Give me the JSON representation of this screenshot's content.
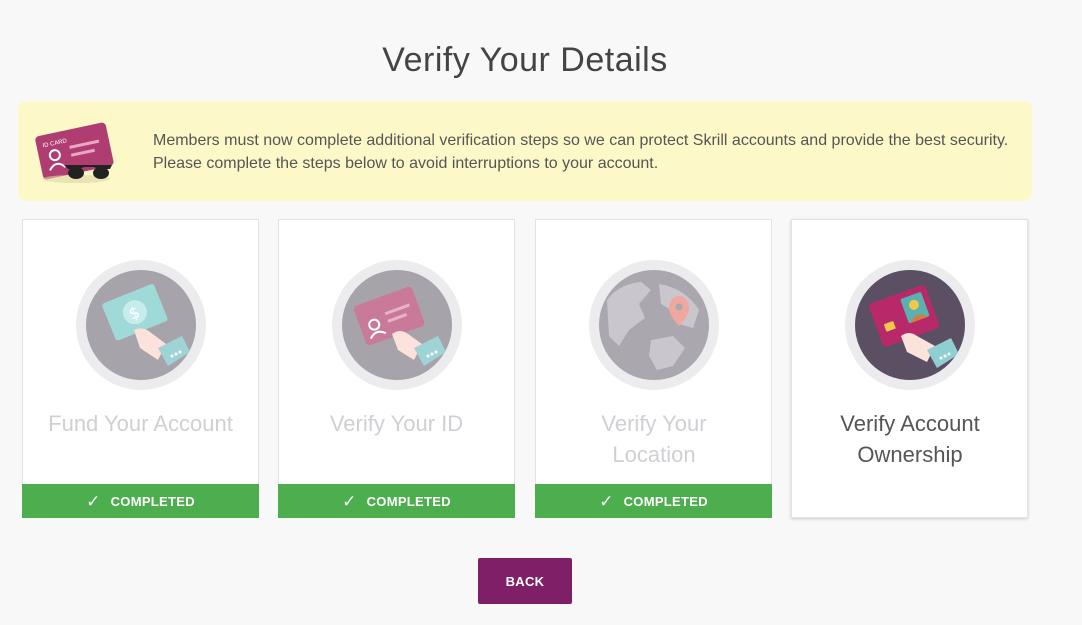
{
  "page": {
    "title": "Verify Your Details"
  },
  "notice": {
    "icon": "id-card-sunglasses-icon",
    "card_text": "ID CARD",
    "text": "Members must now complete additional verification steps so we can protect Skrill accounts and provide the best security. Please complete the steps below to avoid interruptions to your account."
  },
  "steps": [
    {
      "label": "Fund Your Account",
      "icon": "money-hand-icon",
      "status": "COMPLETED"
    },
    {
      "label": "Verify Your ID",
      "icon": "id-card-hand-icon",
      "status": "COMPLETED"
    },
    {
      "label": "Verify Your Location",
      "icon": "globe-pin-icon",
      "status": "COMPLETED"
    },
    {
      "label": "Verify Account Ownership",
      "icon": "card-hand-icon",
      "status": ""
    }
  ],
  "actions": {
    "back_label": "BACK"
  },
  "colors": {
    "brand": "#7f1f68",
    "completed": "#4cae4c",
    "notice_bg": "#fdf8c8"
  }
}
